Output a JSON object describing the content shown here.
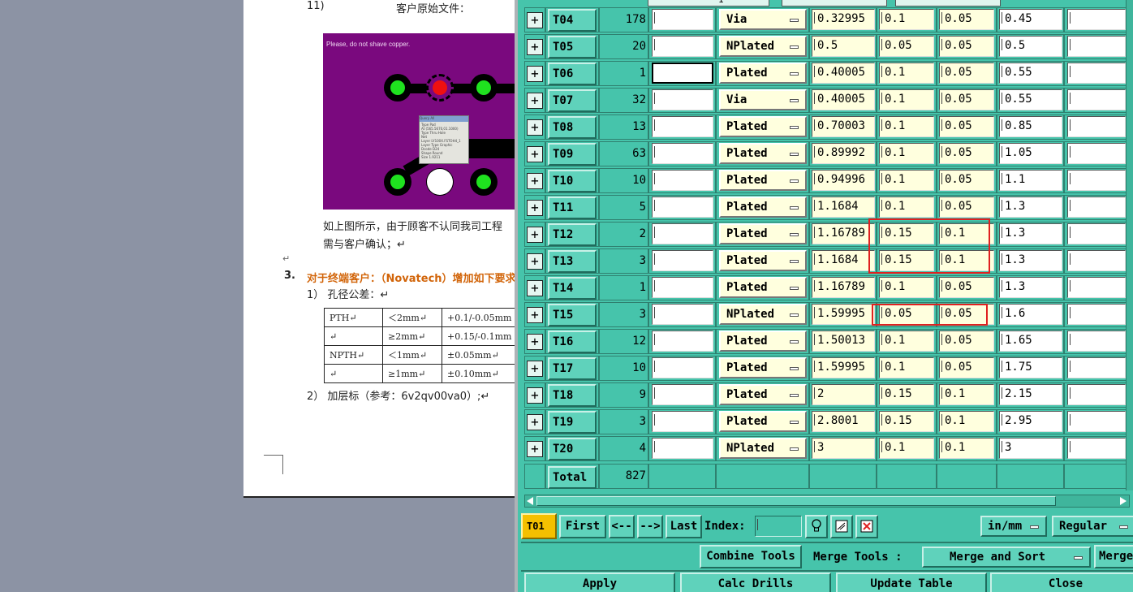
{
  "document": {
    "item11_num": "11)",
    "item11_text": "客户原始文件：",
    "pcb_note": "Please, do not shave copper.",
    "info_title": "Query All",
    "info_lines": [
      "Type   Pad",
      "At     (565.5670,01.1000)",
      "Type   Thru Hole",
      "Net",
      "Layer  LY100X.FSTOH4_1",
      "Layer Type  Graphic",
      "Dcode  D24",
      "Shape  Round",
      "Size   1.9211"
    ],
    "para_line1": "如上图所示，由于顾客不认同我司工程",
    "para_line2": "需与客户确认；↵",
    "empty_mark": "↵",
    "section_num": "3.",
    "section_title": "对于终端客户：（Novatech）增加如下要求",
    "sub1": "1） 孔径公差：↵",
    "tol_rows": [
      [
        "PTH↵",
        "＜2mm↵",
        "+0.1/-0.05mm"
      ],
      [
        "↵",
        "≥2mm↵",
        "+0.15/-0.1mm"
      ],
      [
        "NPTH↵",
        "＜1mm↵",
        "±0.05mm↵"
      ],
      [
        "↵",
        "≥1mm↵",
        "±0.10mm↵"
      ]
    ],
    "sub2": "2） 加层标（参考：6v2qv00va0）;↵"
  },
  "tool_table": {
    "top_fragment": "1",
    "rows": [
      {
        "tool": "T04",
        "count": "178",
        "type": "Via",
        "size": "0.32995",
        "tol_plus": "0.1",
        "tol_minus": "0.05",
        "finish": "0.45"
      },
      {
        "tool": "T05",
        "count": "20",
        "type": "NPlated",
        "size": "0.5",
        "tol_plus": "0.05",
        "tol_minus": "0.05",
        "finish": "0.5"
      },
      {
        "tool": "T06",
        "count": "1",
        "type": "Plated",
        "size": "0.40005",
        "tol_plus": "0.1",
        "tol_minus": "0.05",
        "finish": "0.55"
      },
      {
        "tool": "T07",
        "count": "32",
        "type": "Via",
        "size": "0.40005",
        "tol_plus": "0.1",
        "tol_minus": "0.05",
        "finish": "0.55"
      },
      {
        "tool": "T08",
        "count": "13",
        "type": "Plated",
        "size": "0.70003",
        "tol_plus": "0.1",
        "tol_minus": "0.05",
        "finish": "0.85"
      },
      {
        "tool": "T09",
        "count": "63",
        "type": "Plated",
        "size": "0.89992",
        "tol_plus": "0.1",
        "tol_minus": "0.05",
        "finish": "1.05"
      },
      {
        "tool": "T10",
        "count": "10",
        "type": "Plated",
        "size": "0.94996",
        "tol_plus": "0.1",
        "tol_minus": "0.05",
        "finish": "1.1"
      },
      {
        "tool": "T11",
        "count": "5",
        "type": "Plated",
        "size": "1.1684",
        "tol_plus": "0.1",
        "tol_minus": "0.05",
        "finish": "1.3"
      },
      {
        "tool": "T12",
        "count": "2",
        "type": "Plated",
        "size": "1.16789",
        "tol_plus": "0.15",
        "tol_minus": "0.1",
        "finish": "1.3"
      },
      {
        "tool": "T13",
        "count": "3",
        "type": "Plated",
        "size": "1.1684",
        "tol_plus": "0.15",
        "tol_minus": "0.1",
        "finish": "1.3"
      },
      {
        "tool": "T14",
        "count": "1",
        "type": "Plated",
        "size": "1.16789",
        "tol_plus": "0.1",
        "tol_minus": "0.05",
        "finish": "1.3"
      },
      {
        "tool": "T15",
        "count": "3",
        "type": "NPlated",
        "size": "1.59995",
        "tol_plus": "0.05",
        "tol_minus": "0.05",
        "finish": "1.6"
      },
      {
        "tool": "T16",
        "count": "12",
        "type": "Plated",
        "size": "1.50013",
        "tol_plus": "0.1",
        "tol_minus": "0.05",
        "finish": "1.65"
      },
      {
        "tool": "T17",
        "count": "10",
        "type": "Plated",
        "size": "1.59995",
        "tol_plus": "0.1",
        "tol_minus": "0.05",
        "finish": "1.75"
      },
      {
        "tool": "T18",
        "count": "9",
        "type": "Plated",
        "size": "2",
        "tol_plus": "0.15",
        "tol_minus": "0.1",
        "finish": "2.15"
      },
      {
        "tool": "T19",
        "count": "3",
        "type": "Plated",
        "size": "2.8001",
        "tol_plus": "0.15",
        "tol_minus": "0.1",
        "finish": "2.95"
      },
      {
        "tool": "T20",
        "count": "4",
        "type": "NPlated",
        "size": "3",
        "tol_plus": "0.1",
        "tol_minus": "0.1",
        "finish": "3"
      }
    ],
    "total_label": "Total",
    "total_count": "827",
    "highlighted_rows": [
      "T12",
      "T13",
      "T15"
    ]
  },
  "nav": {
    "current_tool": "T01",
    "first": "First",
    "prev": "<--",
    "next": "-->",
    "last": "Last",
    "index_label": "Index:",
    "units": "in/mm",
    "mode": "Regular"
  },
  "merge": {
    "combine": "Combine Tools",
    "merge_label": "Merge Tools :",
    "merge_option": "Merge and Sort",
    "merge_cut": "Merge"
  },
  "actions": {
    "apply": "Apply",
    "calc": "Calc Drills",
    "update": "Update Table",
    "close": "Close"
  },
  "colors": {
    "window_bg": "#46c4ab",
    "highlight": "#e02020",
    "current_tool_bg": "#f5c000",
    "pcb_board": "#7a097e"
  }
}
